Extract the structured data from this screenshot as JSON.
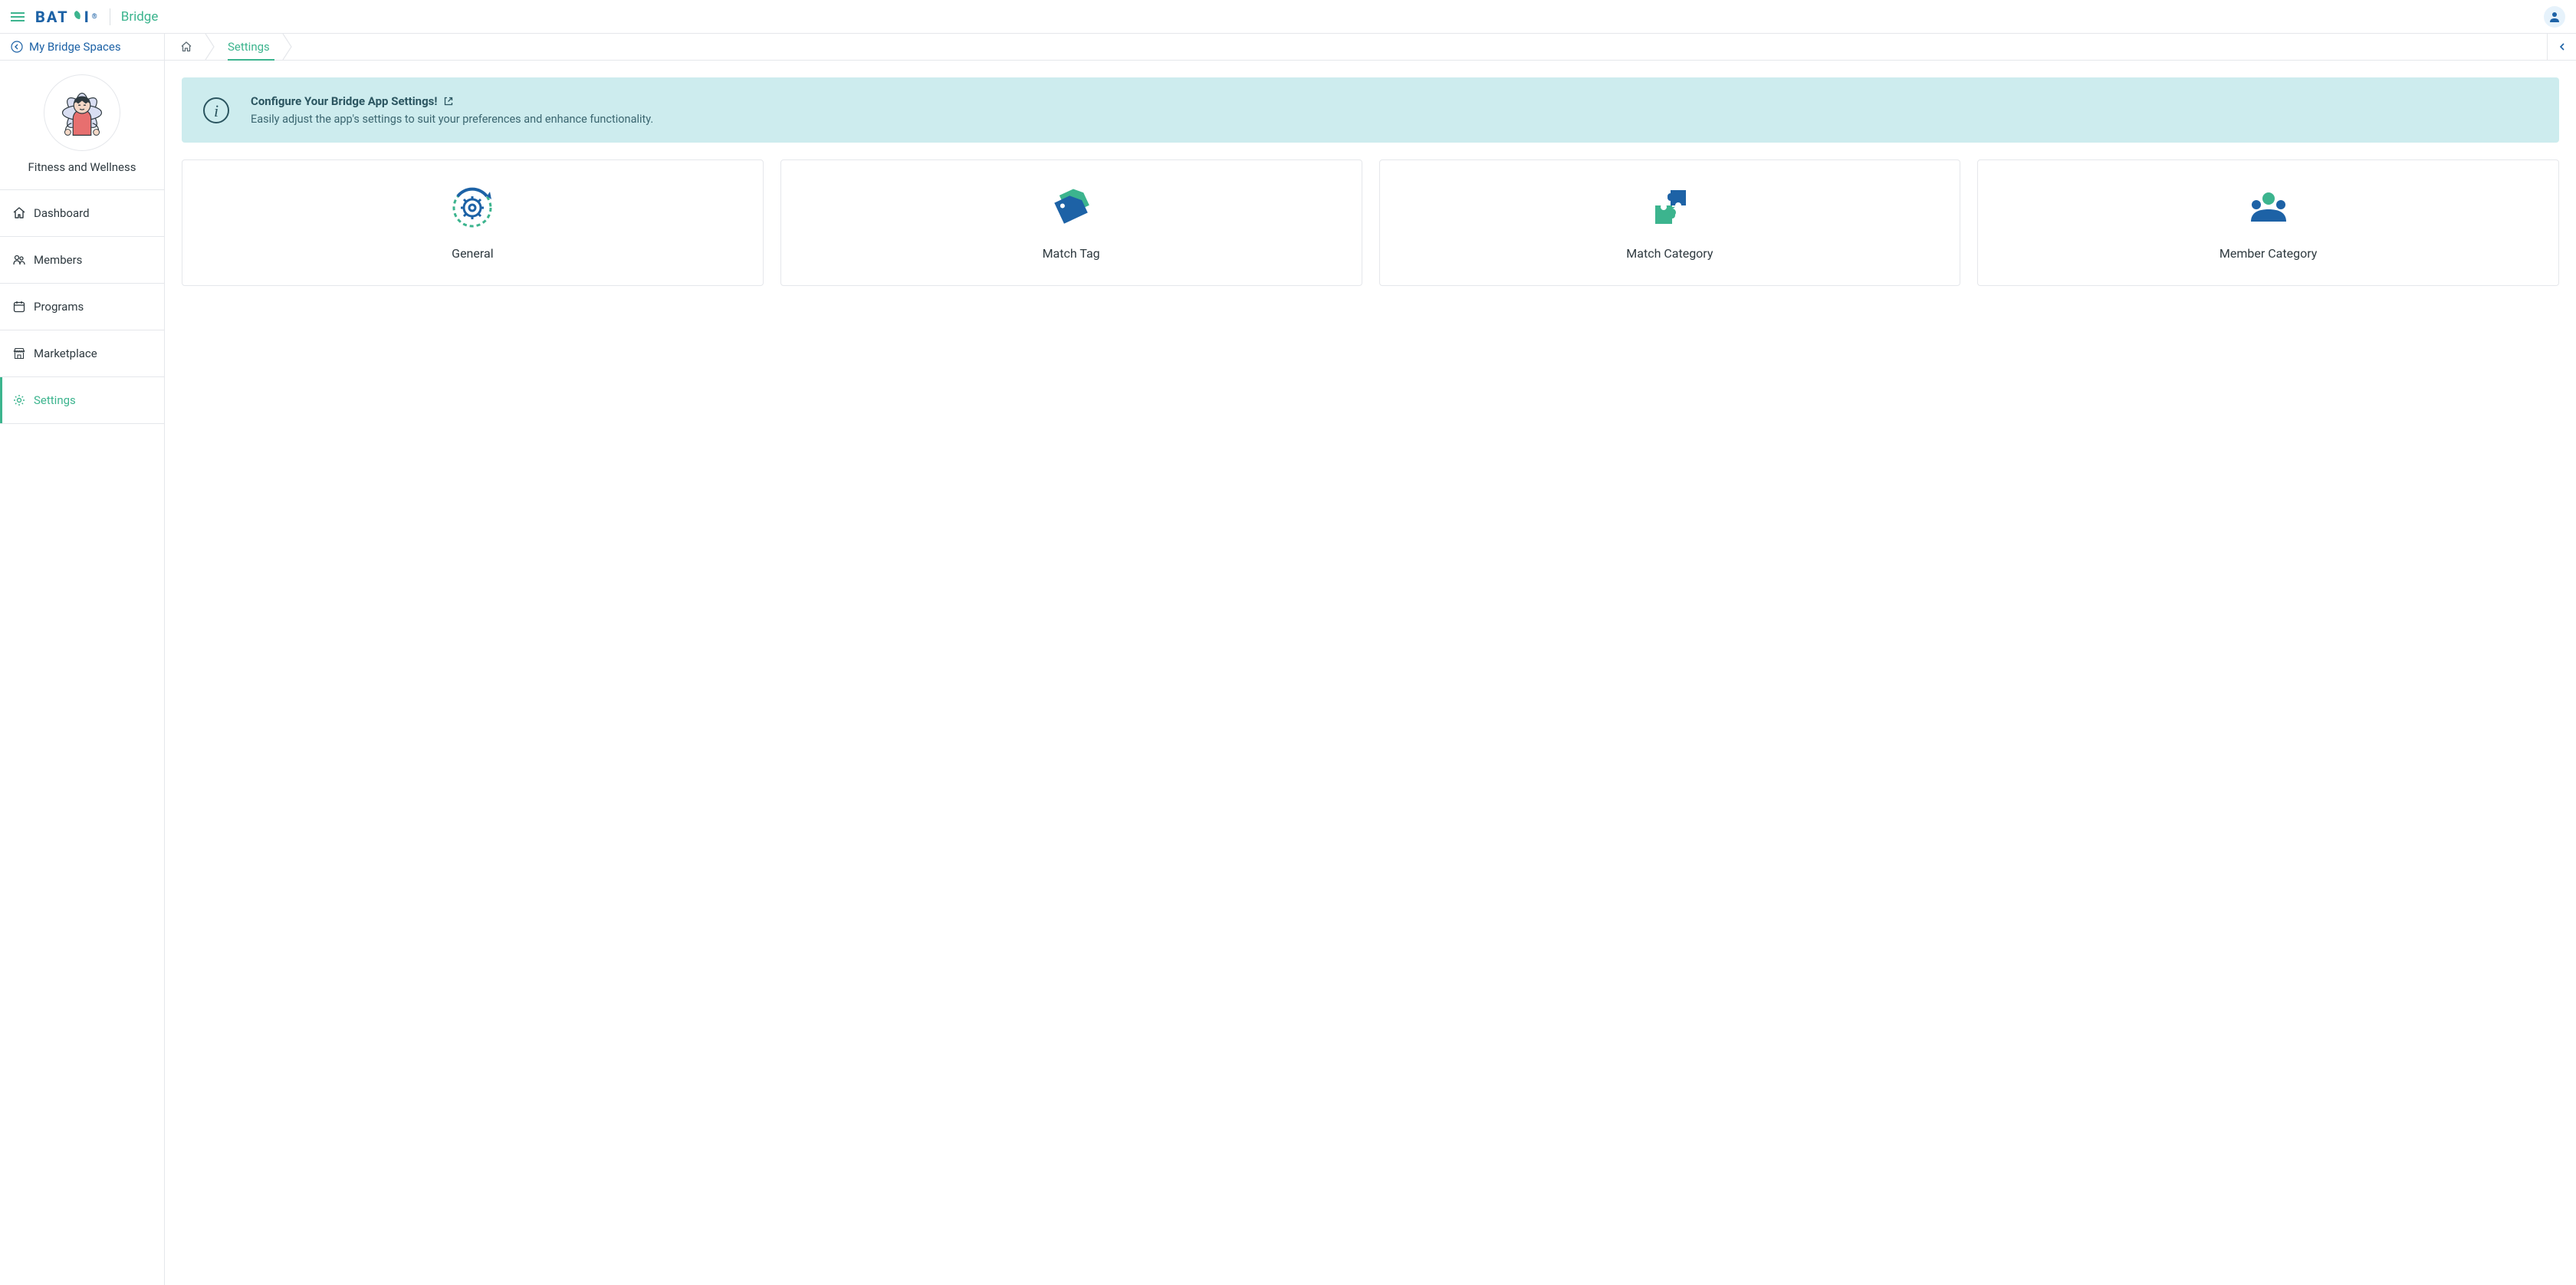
{
  "header": {
    "brand_prefix": "BAT",
    "brand_suffix": "I",
    "app_name": "Bridge"
  },
  "sidebar": {
    "back_label": "My Bridge Spaces",
    "org_name": "Fitness and Wellness",
    "nav": [
      {
        "label": "Dashboard",
        "icon": "home"
      },
      {
        "label": "Members",
        "icon": "people"
      },
      {
        "label": "Programs",
        "icon": "calendar"
      },
      {
        "label": "Marketplace",
        "icon": "store"
      },
      {
        "label": "Settings",
        "icon": "gear",
        "active": true
      }
    ]
  },
  "breadcrumb": {
    "home": "home",
    "current": "Settings"
  },
  "info_banner": {
    "title": "Configure Your Bridge App Settings!",
    "body": "Easily adjust the app's settings to suit your preferences and enhance functionality."
  },
  "cards": [
    {
      "label": "General"
    },
    {
      "label": "Match Tag"
    },
    {
      "label": "Match Category"
    },
    {
      "label": "Member Category"
    }
  ],
  "colors": {
    "primary_blue": "#1d62a6",
    "primary_green": "#3cb48e",
    "banner_bg": "#cdecee"
  }
}
